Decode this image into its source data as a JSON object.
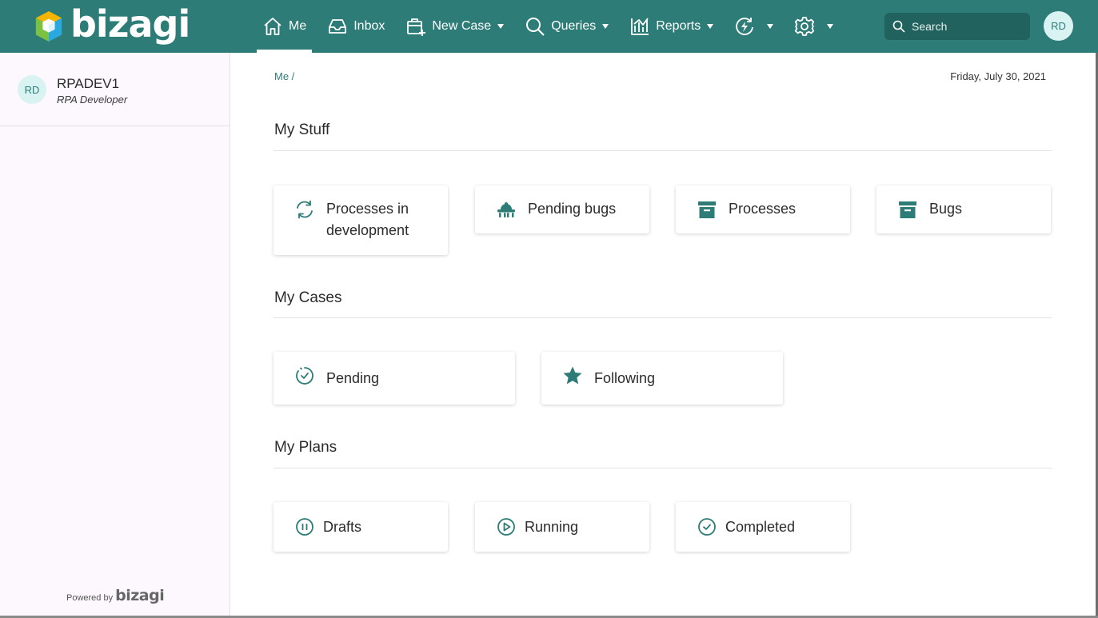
{
  "app": {
    "logo_text": "bizagi",
    "brand_color": "#2e7c78"
  },
  "nav": {
    "me": "Me",
    "inbox": "Inbox",
    "new_case": "New Case",
    "queries": "Queries",
    "reports": "Reports"
  },
  "search": {
    "placeholder": "Search"
  },
  "user": {
    "initials": "RD",
    "name": "RPADEV1",
    "role": "RPA Developer"
  },
  "footer": {
    "powered_by": "Powered by",
    "logo_text": "bizagi"
  },
  "breadcrumb": "Me /",
  "date": "Friday, July 30, 2021",
  "sections": {
    "my_stuff": {
      "title": "My Stuff",
      "cards": [
        {
          "label": "Processes in development",
          "icon": "refresh-icon"
        },
        {
          "label": "Pending bugs",
          "icon": "bug-icon"
        },
        {
          "label": "Processes",
          "icon": "archive-icon"
        },
        {
          "label": "Bugs",
          "icon": "archive-icon"
        }
      ]
    },
    "my_cases": {
      "title": "My Cases",
      "cards": [
        {
          "label": "Pending",
          "icon": "timer-icon"
        },
        {
          "label": "Following",
          "icon": "star-icon"
        }
      ]
    },
    "my_plans": {
      "title": "My Plans",
      "cards": [
        {
          "label": "Drafts",
          "icon": "pause-circle-icon"
        },
        {
          "label": "Running",
          "icon": "play-circle-icon"
        },
        {
          "label": "Completed",
          "icon": "check-circle-icon"
        }
      ]
    }
  }
}
